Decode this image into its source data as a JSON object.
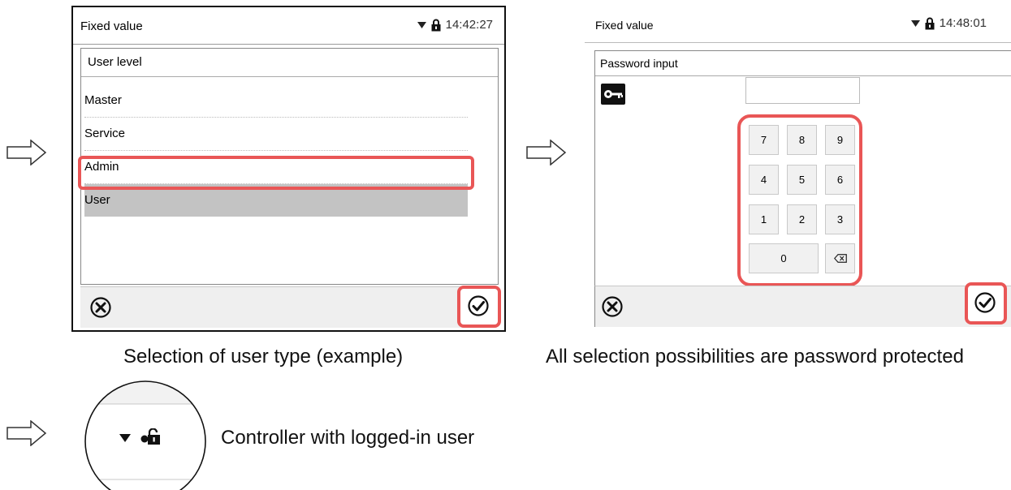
{
  "screen1": {
    "title": "Fixed value",
    "time": "14:42:27",
    "panel_header": "User level",
    "items": [
      "Master",
      "Service",
      "Admin",
      "User"
    ],
    "selected_item": "User"
  },
  "screen2": {
    "title": "Fixed value",
    "time": "14:48:01",
    "panel_header": "Password input",
    "keys": [
      "7",
      "8",
      "9",
      "4",
      "5",
      "6",
      "1",
      "2",
      "3",
      "0"
    ]
  },
  "captions": {
    "screen1": "Selection of user type (example)",
    "screen2": "All selection possibilities are password protected",
    "zoom": "Controller with logged-in user"
  },
  "colors": {
    "highlight": "#e95656",
    "selection": "#c3c3c3",
    "footer": "#efefef"
  }
}
